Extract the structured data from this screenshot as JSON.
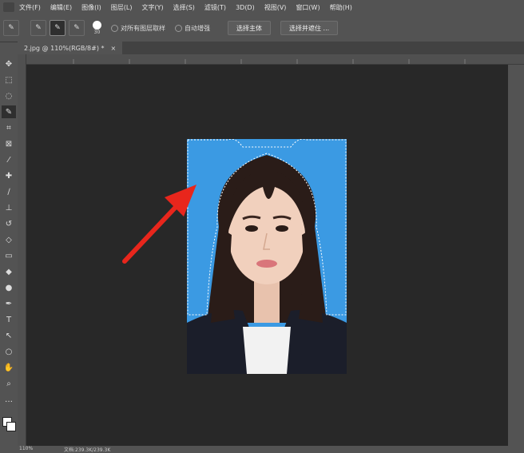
{
  "menu": [
    "文件(F)",
    "编辑(E)",
    "图像(I)",
    "图层(L)",
    "文字(Y)",
    "选择(S)",
    "滤镜(T)",
    "3D(D)",
    "视图(V)",
    "窗口(W)",
    "帮助(H)"
  ],
  "options": {
    "brush_size": "30",
    "sample_all_label": "对所有图层取样",
    "auto_enhance_label": "自动增强",
    "select_subject_label": "选择主体",
    "select_mask_label": "选择并遮住 ..."
  },
  "document": {
    "tab_label": "2.jpg @ 110%(RGB/8#) *",
    "close": "×"
  },
  "status": {
    "zoom": "110%",
    "doc_size": "文档:239.3K/239.3K"
  },
  "icons": [
    "quick-selection-icon",
    "move-icon",
    "marquee-icon",
    "lasso-icon",
    "crop-icon",
    "eyedropper-icon",
    "brush-icon",
    "stamp-icon",
    "eraser-icon",
    "gradient-icon",
    "pen-icon",
    "type-icon",
    "path-select-icon",
    "shape-icon",
    "hand-icon",
    "zoom-icon"
  ],
  "colors": {
    "photo_background": "#3b9ae3",
    "arrow": "#e8261c"
  }
}
